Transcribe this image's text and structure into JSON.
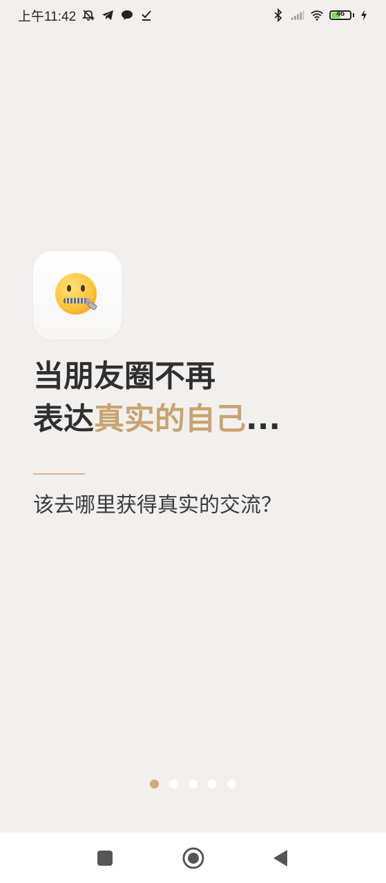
{
  "status_bar": {
    "time": "上午11:42",
    "battery_level": "46",
    "icons": [
      "mute-icon",
      "telegram-icon",
      "chat-icon",
      "download-icon",
      "bluetooth-icon",
      "signal-icon",
      "wifi-icon",
      "battery-icon",
      "charging-icon"
    ]
  },
  "onboarding": {
    "emoji_icon": "zipper-mouth-face",
    "headline_line1": "当朋友圈不再",
    "headline_line2_prefix": "表达",
    "headline_line2_accent": "真实的自己",
    "headline_line2_suffix": "...",
    "subtitle": "该去哪里获得真实的交流？",
    "accent_color": "#c9a36f",
    "page_count": 5,
    "active_page": 1
  },
  "nav_bar": {
    "recents": "recents-button",
    "home": "home-button",
    "back": "back-button"
  }
}
